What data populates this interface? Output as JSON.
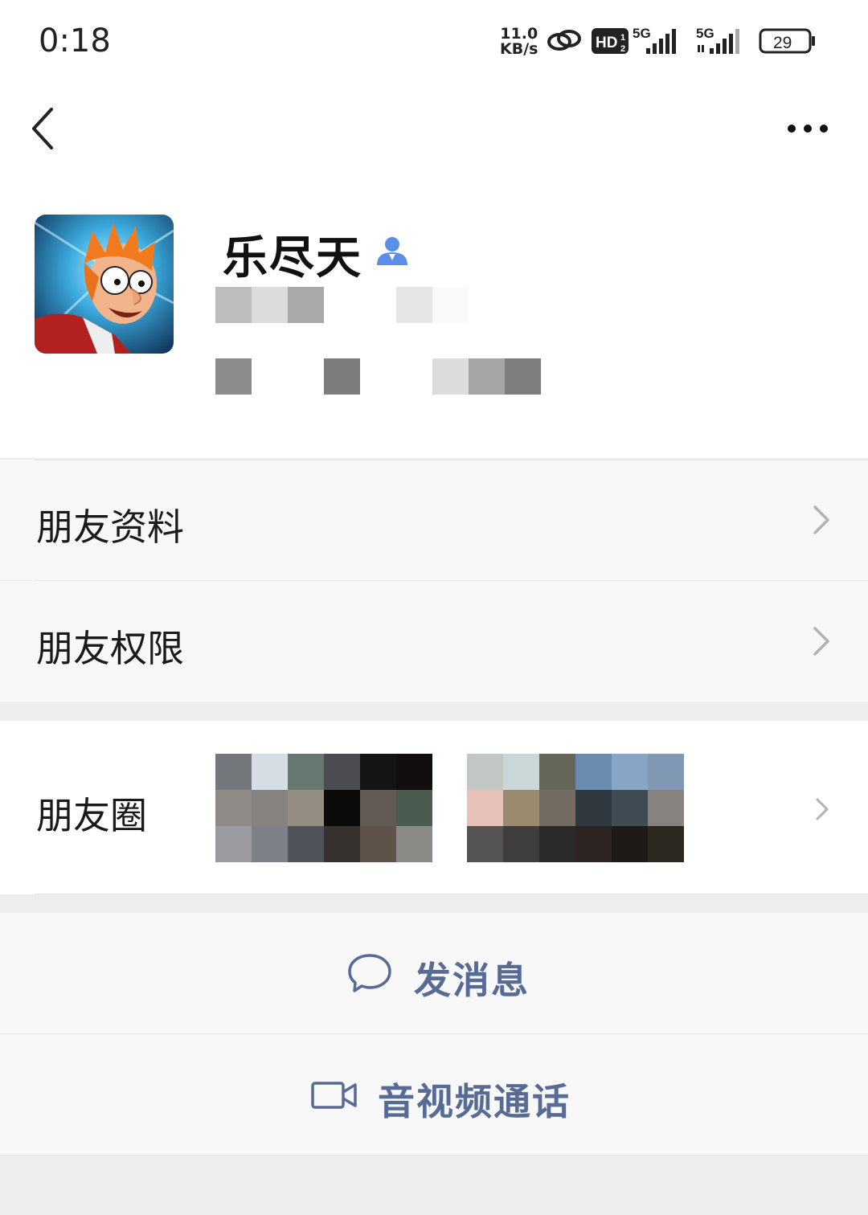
{
  "status_bar": {
    "time": "0:18",
    "net_speed_value": "11.0",
    "net_speed_unit": "KB/s",
    "hd_label": "HD",
    "signal_1_label": "5G",
    "signal_2_label": "5G",
    "battery": "29"
  },
  "profile": {
    "nickname": "乐尽天"
  },
  "menu": {
    "friend_info": "朋友资料",
    "friend_permissions": "朋友权限",
    "moments": "朋友圈"
  },
  "actions": {
    "send_message": "发消息",
    "av_call": "音视频通话"
  },
  "colors": {
    "link": "#576b95",
    "background": "#ededed",
    "row": "#f8f8f8",
    "contact_badge": "#5a8ee8"
  }
}
